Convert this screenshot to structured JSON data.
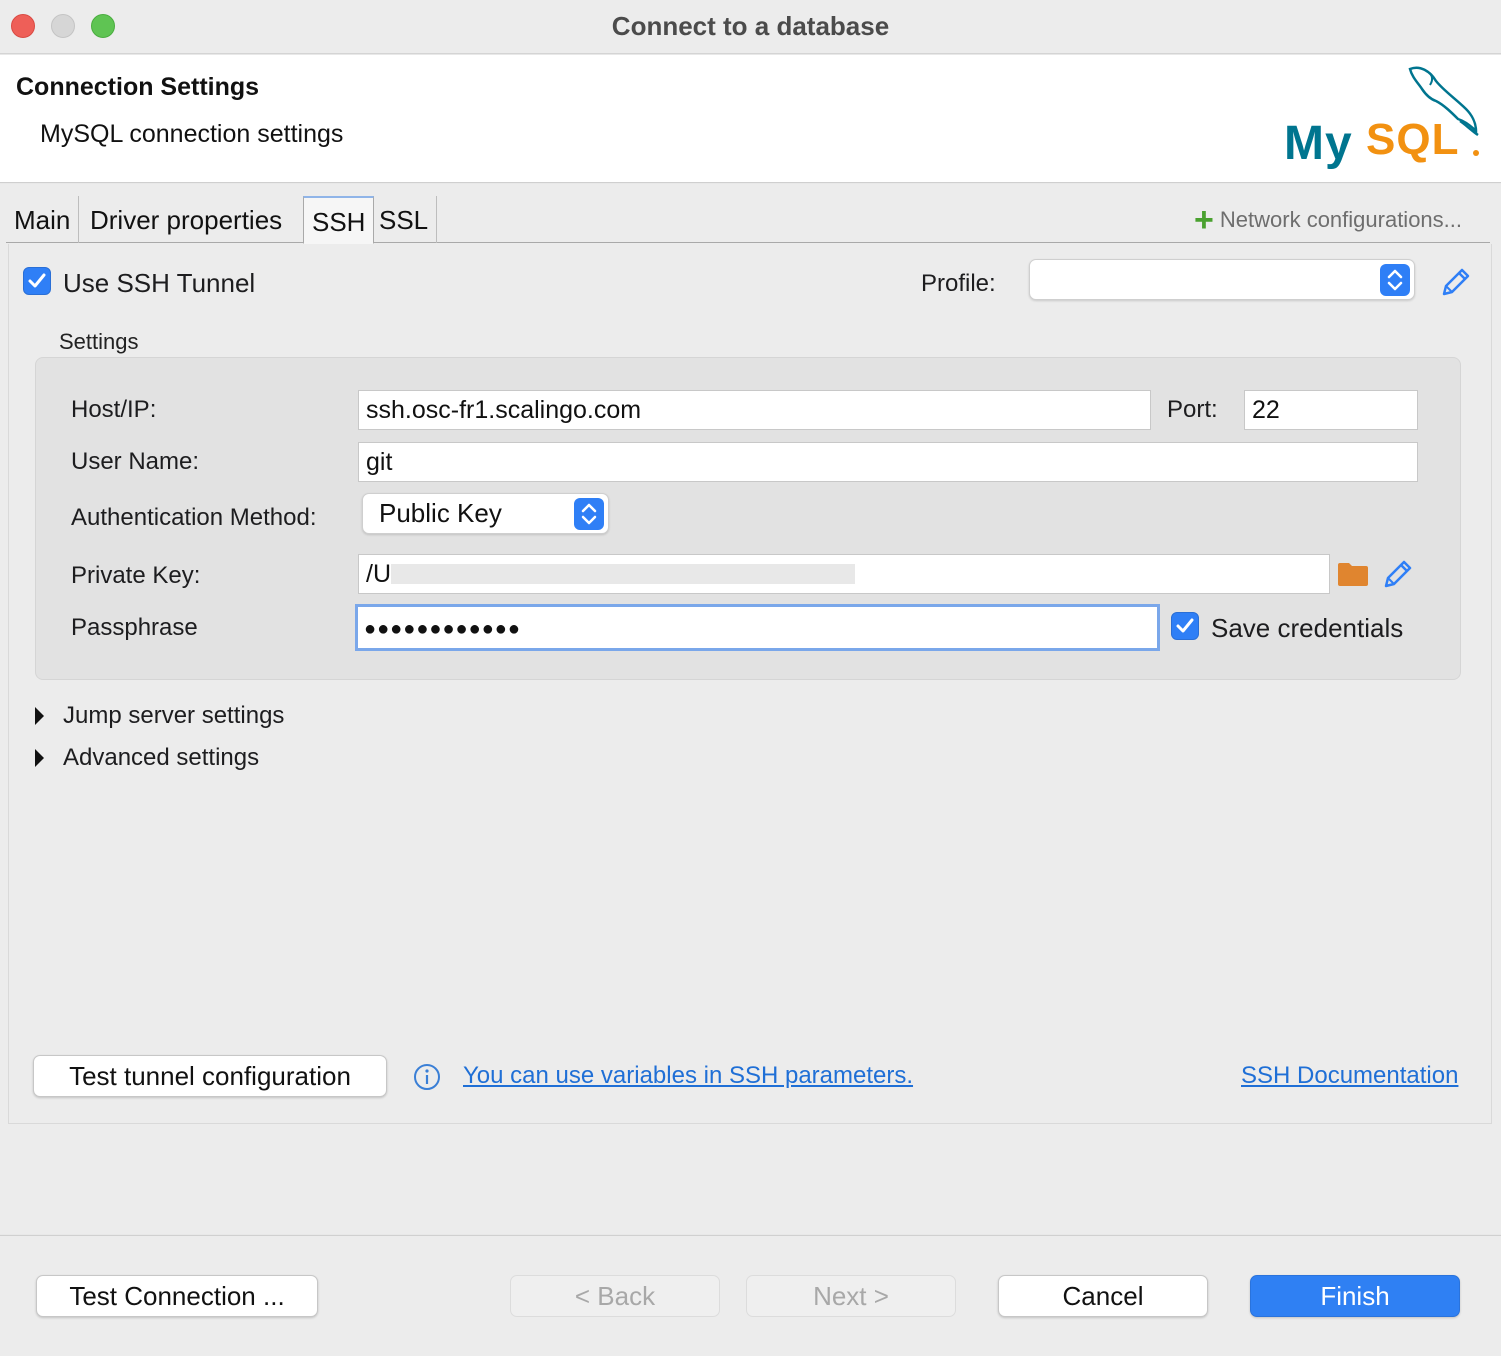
{
  "window": {
    "title": "Connect to a database"
  },
  "header": {
    "title": "Connection Settings",
    "subtitle": "MySQL connection settings",
    "logo_text": "MySQL"
  },
  "tabs": [
    {
      "label": "Main",
      "active": false
    },
    {
      "label": "Driver properties",
      "active": false
    },
    {
      "label": "SSH",
      "active": true
    },
    {
      "label": "SSL",
      "active": false
    }
  ],
  "network_configurations": "Network configurations...",
  "ssh": {
    "use_tunnel_label": "Use SSH Tunnel",
    "use_tunnel_checked": true,
    "profile_label": "Profile:",
    "profile_value": "",
    "settings_title": "Settings",
    "host_label": "Host/IP:",
    "host_value": "ssh.osc-fr1.scalingo.com",
    "port_label": "Port:",
    "port_value": "22",
    "user_label": "User Name:",
    "user_value": "git",
    "auth_label": "Authentication Method:",
    "auth_value": "Public Key",
    "private_key_label": "Private Key:",
    "private_key_value": "/U",
    "passphrase_label": "Passphrase",
    "passphrase_value": "●●●●●●●●●●●●",
    "save_credentials_label": "Save credentials",
    "save_credentials_checked": true,
    "jump_server_label": "Jump server settings",
    "advanced_label": "Advanced settings",
    "test_tunnel_button": "Test tunnel configuration",
    "variables_link": "You can use variables in SSH parameters.",
    "docs_link": "SSH Documentation"
  },
  "footer": {
    "test_connection": "Test Connection ...",
    "back": "< Back",
    "next": "Next >",
    "cancel": "Cancel",
    "finish": "Finish"
  },
  "colors": {
    "accent": "#2f80f3",
    "link": "#1f6fd6",
    "plus": "#4aa12f",
    "folder": "#e0852f",
    "mysql_blue": "#00758f",
    "mysql_orange": "#f29111"
  }
}
